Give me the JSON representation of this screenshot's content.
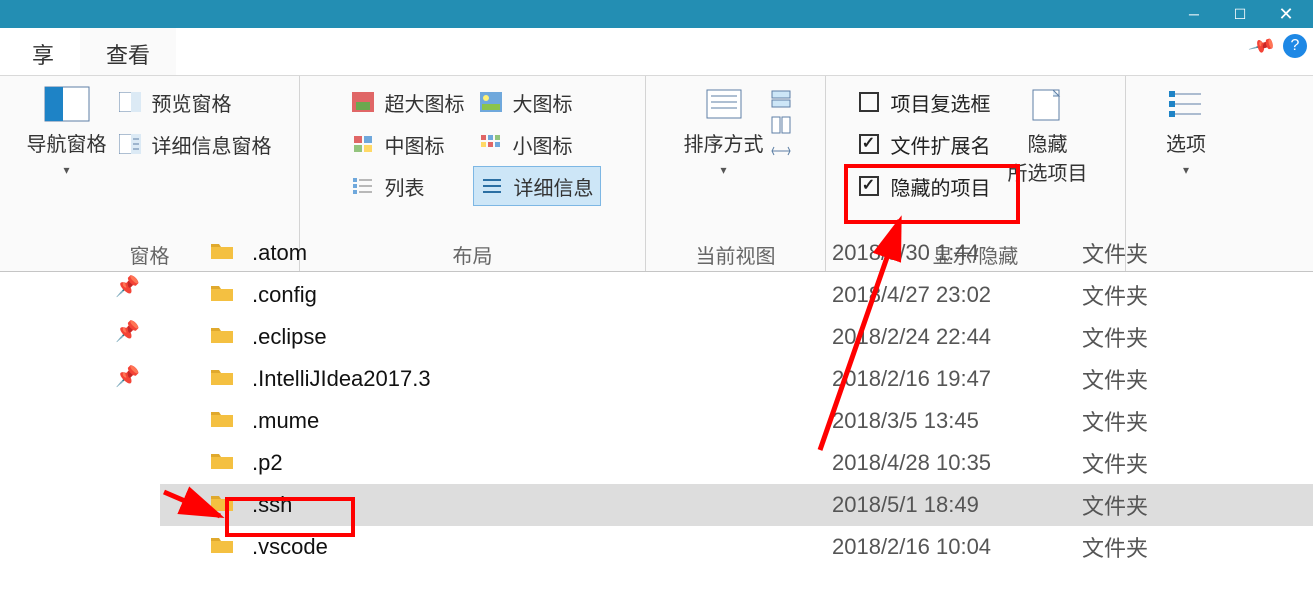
{
  "tabs": {
    "share": "享",
    "view": "查看"
  },
  "ribbon": {
    "panes": {
      "group_label": "窗格",
      "navigation_pane": "导航窗格",
      "preview_pane": "预览窗格",
      "details_pane": "详细信息窗格"
    },
    "layout": {
      "group_label": "布局",
      "extra_large": "超大图标",
      "large": "大图标",
      "medium": "中图标",
      "small": "小图标",
      "list": "列表",
      "details": "详细信息"
    },
    "current_view": {
      "group_label": "当前视图",
      "sort_by": "排序方式"
    },
    "show_hide": {
      "group_label": "显示/隐藏",
      "item_checkboxes": "项目复选框",
      "file_ext": "文件扩展名",
      "hidden_items": "隐藏的项目",
      "hide_selected_line1": "隐藏",
      "hide_selected_line2": "所选项目"
    },
    "options": {
      "label": "选项"
    }
  },
  "help": {
    "tooltip": "?"
  },
  "files": [
    {
      "name": ".atom",
      "date": "2018/3/30 1:44",
      "type": "文件夹",
      "selected": false,
      "cut": true
    },
    {
      "name": ".config",
      "date": "2018/4/27 23:02",
      "type": "文件夹",
      "selected": false
    },
    {
      "name": ".eclipse",
      "date": "2018/2/24 22:44",
      "type": "文件夹",
      "selected": false
    },
    {
      "name": ".IntelliJIdea2017.3",
      "date": "2018/2/16 19:47",
      "type": "文件夹",
      "selected": false
    },
    {
      "name": ".mume",
      "date": "2018/3/5 13:45",
      "type": "文件夹",
      "selected": false
    },
    {
      "name": ".p2",
      "date": "2018/4/28 10:35",
      "type": "文件夹",
      "selected": false
    },
    {
      "name": ".ssh",
      "date": "2018/5/1 18:49",
      "type": "文件夹",
      "selected": true
    },
    {
      "name": ".vscode",
      "date": "2018/2/16 10:04",
      "type": "文件夹",
      "selected": false
    }
  ]
}
